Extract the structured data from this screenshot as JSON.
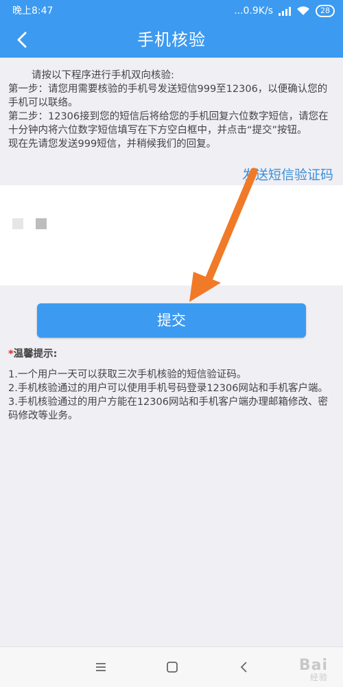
{
  "status_bar": {
    "time": "晚上8:47",
    "speed": "...0.9K/s",
    "battery": "28"
  },
  "header": {
    "title": "手机核验"
  },
  "intro": {
    "line1": "请按以下程序进行手机双向核验:",
    "step1": "第一步：请您用需要核验的手机号发送短信999至12306，以便确认您的手机可以联络。",
    "step2": "第二步：12306接到您的短信后将给您的手机回复六位数字短信，请您在十分钟内将六位数字短信填写在下方空白框中，并点击“提交”按钮。",
    "step3": "现在先请您发送999短信，并稍候我们的回复。"
  },
  "send_code_label": "发送短信验证码",
  "submit_label": "提交",
  "tips": {
    "star": "*",
    "title": "温馨提示:",
    "items": [
      "1.一个用户一天可以获取三次手机核验的短信验证码。",
      "2.手机核验通过的用户可以使用手机号码登录12306网站和手机客户端。",
      "3.手机核验通过的用户方能在12306网站和手机客户端办理邮箱修改、密码修改等业务。"
    ]
  },
  "watermark": {
    "brand": "Bai",
    "sub": "经验"
  },
  "colors": {
    "primary": "#3c9af0",
    "link": "#3b8fd8",
    "arrow": "#f07a28",
    "star": "#e2231a"
  }
}
